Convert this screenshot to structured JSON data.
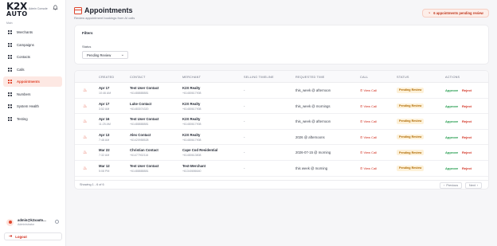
{
  "brand": {
    "logo_top": "K2X",
    "logo_bottom": "AUTO",
    "subtitle": "Admin Console"
  },
  "sidebar": {
    "section": "Main",
    "items": [
      {
        "label": "Merchants",
        "icon": "grid-icon"
      },
      {
        "label": "Campaigns",
        "icon": "grid-icon"
      },
      {
        "label": "Contacts",
        "icon": "grid-icon"
      },
      {
        "label": "Calls",
        "icon": "grid-icon"
      },
      {
        "label": "Appointments",
        "icon": "grid-icon",
        "active": true
      },
      {
        "label": "Numbers",
        "icon": "grid-icon"
      },
      {
        "label": "System Health",
        "icon": "grid-icon"
      },
      {
        "label": "Testing",
        "icon": "grid-icon"
      }
    ]
  },
  "user": {
    "name": "admin@k2xauto...",
    "role": "Administrator"
  },
  "logout_label": "Logout",
  "header": {
    "title": "Appointments",
    "subtitle": "Review appointment bookings from AI calls",
    "pending_label": "6 appointments pending review"
  },
  "filters": {
    "title": "Filters",
    "status_label": "Status",
    "status_value": "Pending Review"
  },
  "table": {
    "columns": [
      "CREATED",
      "CONTACT",
      "MERCHANT",
      "SELLING TIMELINE",
      "REQUESTED TIME",
      "CALL",
      "STATUS",
      "ACTIONS"
    ],
    "rows": [
      {
        "date": "Apr 17",
        "time": "10:46 AM",
        "contact": "Test User Contact",
        "contact_phone": "+61488888881",
        "merchant": "K2X Realty",
        "merchant_phone": "+61480617908",
        "timeline": "-",
        "requested": "this_week @ afternoon",
        "call": "View Call",
        "status": "Pending Review",
        "approve": "Approve",
        "reject": "Reject"
      },
      {
        "date": "Apr 17",
        "time": "3:52 AM",
        "contact": "Luke Contact",
        "contact_phone": "+61483074320",
        "merchant": "K2X Realty",
        "merchant_phone": "+61480617908",
        "timeline": "-",
        "requested": "this_week @ mornings",
        "call": "View Call",
        "status": "Pending Review",
        "approve": "Approve",
        "reject": "Reject"
      },
      {
        "date": "Apr 16",
        "time": "11:25 AM",
        "contact": "Test User Contact",
        "contact_phone": "+61488888881",
        "merchant": "K2X Realty",
        "merchant_phone": "+61480617908",
        "timeline": "-",
        "requested": "this_week @ afternoon",
        "call": "View Call",
        "status": "Pending Review",
        "approve": "Approve",
        "reject": "Reject"
      },
      {
        "date": "Apr 13",
        "time": "7:48 AM",
        "contact": "Alex Contact",
        "contact_phone": "+61420958528",
        "merchant": "K2X Realty",
        "merchant_phone": "+61480617908",
        "timeline": "-",
        "requested": "2026 @ afternoons",
        "call": "View Call",
        "status": "Pending Review",
        "approve": "Approve",
        "reject": "Reject"
      },
      {
        "date": "Mar 22",
        "time": "7:32 AM",
        "contact": "Christian Contact",
        "contact_phone": "+61477902116",
        "merchant": "Cape Cod Residential",
        "merchant_phone": "+61480613808",
        "timeline": "-",
        "requested": "2026-07-15 @ morning",
        "call": "View Call",
        "status": "Pending Review",
        "approve": "Approve",
        "reject": "Reject"
      },
      {
        "date": "Mar 12",
        "time": "5:08 PM",
        "contact": "Test User Contact",
        "contact_phone": "+61488888881",
        "merchant": "Test-Merchant",
        "merchant_phone": "+61340656640",
        "timeline": "-",
        "requested": "this week @ morning",
        "call": "View Call",
        "status": "Pending Review",
        "approve": "Approve",
        "reject": "Reject"
      }
    ],
    "footer": {
      "showing": "Showing 1 - 6 of 6",
      "previous": "Previous",
      "next": "Next"
    }
  },
  "colors": {
    "accent": "#e0452c",
    "approve": "#1f9a4a",
    "reject": "#d12f1f",
    "status_bg": "#fdf1d9"
  }
}
